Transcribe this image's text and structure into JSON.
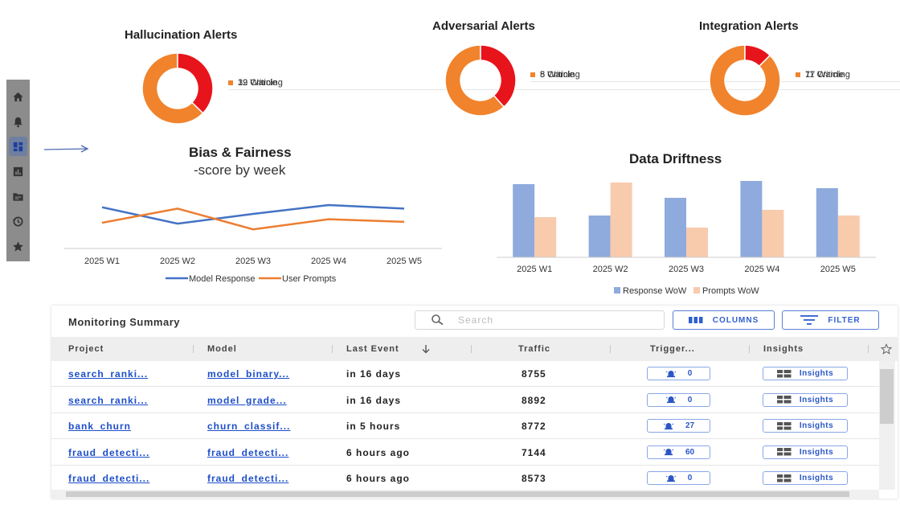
{
  "alerts": {
    "hallucination": {
      "title": "Hallucination Alerts",
      "critical": 19,
      "warning": 32,
      "critical_label": "19 Criticle",
      "warning_label": "32 Warning"
    },
    "adversarial": {
      "title": "Adversarial Alerts",
      "critical": 5,
      "warning": 8,
      "critical_label": "5 Criticle",
      "warning_label": "8 Warning"
    },
    "integration": {
      "title": "Integration Alerts",
      "critical": 11,
      "warning": 77,
      "critical_label": "11 Criticle",
      "warning_label": "77 Warning"
    }
  },
  "colors": {
    "critical": "#e8141c",
    "warning": "#f0832c",
    "line_model": "#4472c4",
    "line_user": "#ed7d31",
    "bar_response": "#8faadc",
    "bar_prompts": "#f8cbad",
    "link": "#1d4ec9"
  },
  "icons": [
    "home-icon",
    "bell-icon",
    "dashboard-icon",
    "bar-chart-icon",
    "folder-icon",
    "history-icon",
    "star-icon"
  ],
  "chart_data": [
    {
      "type": "line",
      "title": "Bias & Fairness",
      "subtitle": "-score by week",
      "categories": [
        "2025 W1",
        "2025 W2",
        "2025 W3",
        "2025 W4",
        "2025 W5"
      ],
      "series": [
        {
          "name": "Model Response",
          "values": [
            0.75,
            0.38,
            0.6,
            0.8,
            0.72
          ]
        },
        {
          "name": "User Prompts",
          "values": [
            0.4,
            0.72,
            0.25,
            0.48,
            0.42
          ]
        }
      ],
      "ylim": [
        0,
        1
      ]
    },
    {
      "type": "bar",
      "title": "Data Driftness",
      "categories": [
        "2025 W1",
        "2025 W2",
        "2025 W3",
        "2025 W4",
        "2025 W5"
      ],
      "series": [
        {
          "name": "Response WoW",
          "values": [
            0.91,
            0.52,
            0.74,
            0.95,
            0.86
          ]
        },
        {
          "name": "Prompts WoW",
          "values": [
            0.5,
            0.93,
            0.37,
            0.59,
            0.52
          ]
        }
      ],
      "ylim": [
        0,
        1
      ]
    }
  ],
  "table": {
    "title": "Monitoring Summary",
    "search_placeholder": "Search",
    "columns_label": "COLUMNS",
    "filter_label": "FILTER",
    "headers": [
      "Project",
      "Model",
      "Last Event",
      "Traffic",
      "Trigger...",
      "Insights"
    ],
    "rows": [
      {
        "project": "search_ranki...",
        "model": "model_binary...",
        "last_event": "in 16 days",
        "traffic": "8755",
        "trigger": "0",
        "insights": "Insights"
      },
      {
        "project": "search_ranki...",
        "model": "model_grade...",
        "last_event": "in 16 days",
        "traffic": "8892",
        "trigger": "0",
        "insights": "Insights"
      },
      {
        "project": "bank_churn",
        "model": "churn_classif...",
        "last_event": "in 5 hours",
        "traffic": "8772",
        "trigger": "27",
        "insights": "Insights"
      },
      {
        "project": "fraud_detecti...",
        "model": "fraud_detecti...",
        "last_event": "6 hours ago",
        "traffic": "7144",
        "trigger": "60",
        "insights": "Insights"
      },
      {
        "project": "fraud_detecti...",
        "model": "fraud_detecti...",
        "last_event": "6 hours ago",
        "traffic": "8573",
        "trigger": "0",
        "insights": "Insights"
      }
    ]
  }
}
